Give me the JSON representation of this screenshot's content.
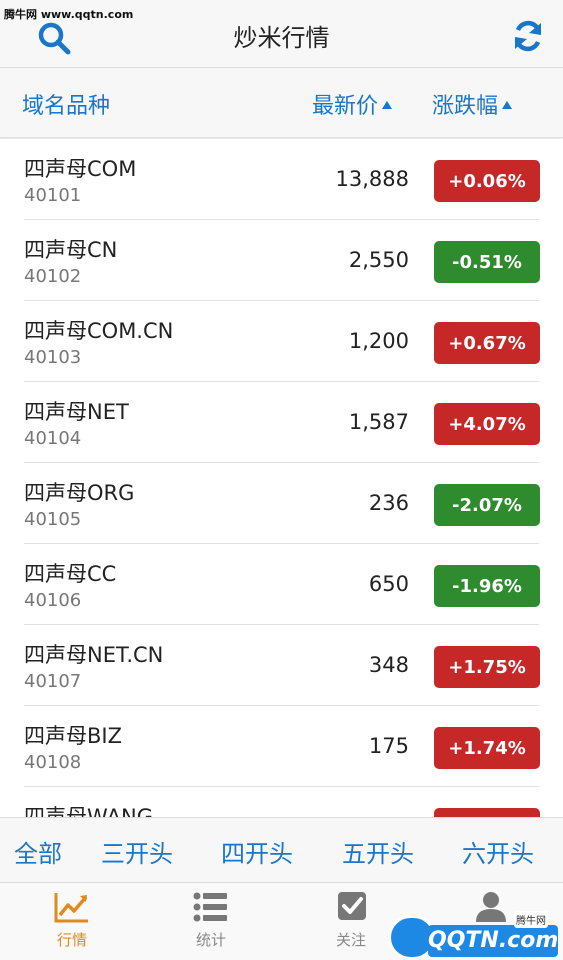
{
  "watermark": "腾牛网 www.qqtn.com",
  "topbar": {
    "title": "炒米行情"
  },
  "header": {
    "name": "域名品种",
    "price": "最新价",
    "change": "涨跌幅"
  },
  "colors": {
    "up": "#c62828",
    "down": "#2e8b2e",
    "accent": "#1976c8",
    "active_tab": "#e08a1e"
  },
  "rows": [
    {
      "name": "四声母COM",
      "code": "40101",
      "price": "13,888",
      "change": "+0.06%",
      "dir": "up"
    },
    {
      "name": "四声母CN",
      "code": "40102",
      "price": "2,550",
      "change": "-0.51%",
      "dir": "down"
    },
    {
      "name": "四声母COM.CN",
      "code": "40103",
      "price": "1,200",
      "change": "+0.67%",
      "dir": "up"
    },
    {
      "name": "四声母NET",
      "code": "40104",
      "price": "1,587",
      "change": "+4.07%",
      "dir": "up"
    },
    {
      "name": "四声母ORG",
      "code": "40105",
      "price": "236",
      "change": "-2.07%",
      "dir": "down"
    },
    {
      "name": "四声母CC",
      "code": "40106",
      "price": "650",
      "change": "-1.96%",
      "dir": "down"
    },
    {
      "name": "四声母NET.CN",
      "code": "40107",
      "price": "348",
      "change": "+1.75%",
      "dir": "up"
    },
    {
      "name": "四声母BIZ",
      "code": "40108",
      "price": "175",
      "change": "+1.74%",
      "dir": "up"
    },
    {
      "name": "四声母WANG",
      "code": "",
      "price": "",
      "change": "",
      "dir": "up"
    }
  ],
  "filters": [
    "全部",
    "三开头",
    "四开头",
    "五开头",
    "六开头"
  ],
  "tabs": [
    {
      "label": "行情",
      "icon": "chart-trend-icon"
    },
    {
      "label": "统计",
      "icon": "list-icon"
    },
    {
      "label": "关注",
      "icon": "checkbox-icon"
    },
    {
      "label": "",
      "icon": "user-icon"
    }
  ],
  "corner_logo": {
    "brand": "QQTN.com",
    "tag": "腾牛网"
  }
}
